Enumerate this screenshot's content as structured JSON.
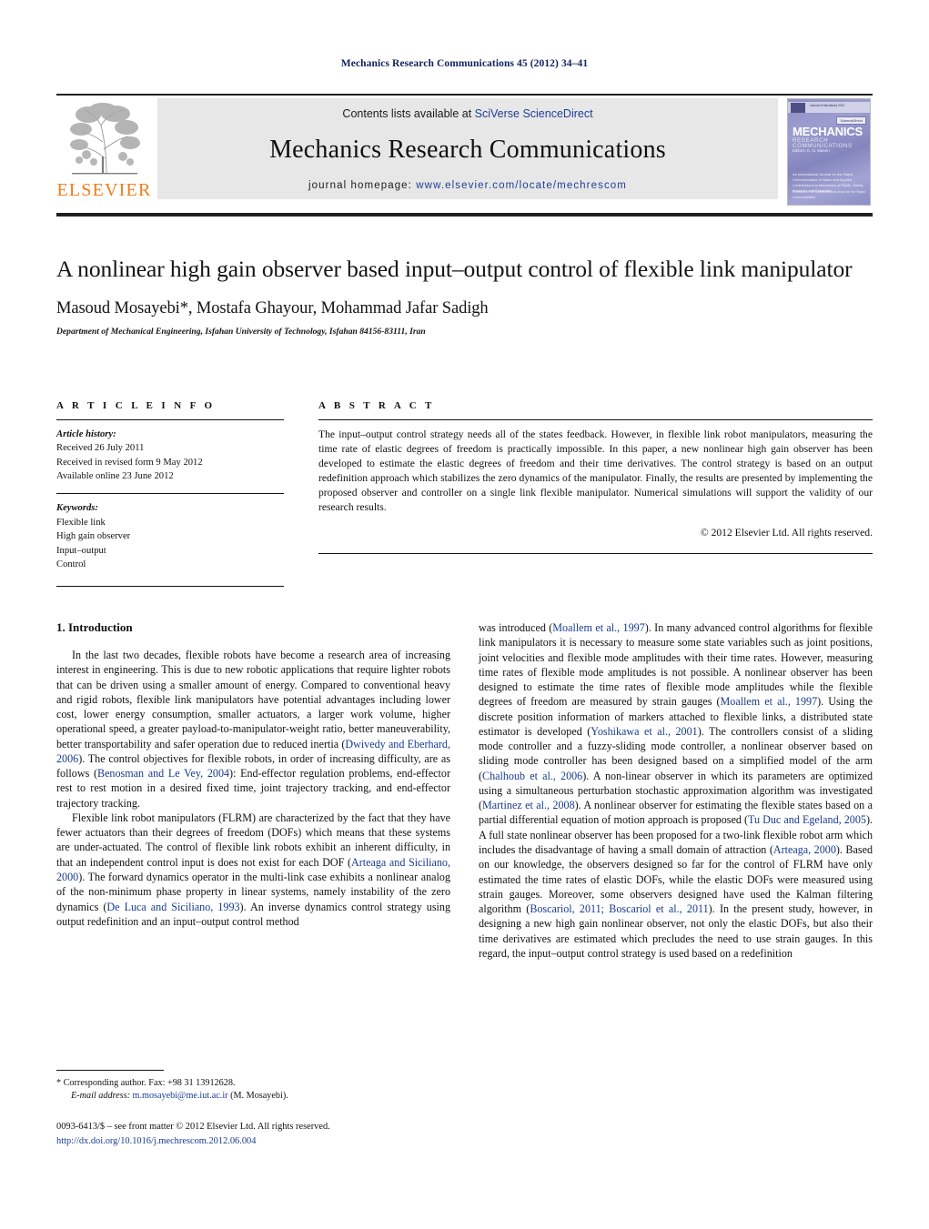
{
  "running_head": {
    "journal": "Mechanics Research Communications",
    "citation": "45 (2012) 34–41"
  },
  "masthead": {
    "publisher_name": "ELSEVIER",
    "contents_prefix": "Contents lists available at ",
    "contents_link": "SciVerse ScienceDirect",
    "journal_title": "Mechanics Research Communications",
    "homepage_prefix": "journal homepage: ",
    "homepage_url": "www.elsevier.com/locate/mechrescom",
    "cover": {
      "title_line1": "MECHANICS",
      "title_line2": "RESEARCH COMMUNICATIONS",
      "editor": "Editors: K. G. Manen",
      "badge": "ScienceDirect",
      "top_text": "Journal of Mechanics 2012",
      "blurb": "An International Journal for the Rapid Communication of Basic and Applied Contributions in Mechanics of Fluids, Solids, Materials and Dynamics",
      "footer": "Founded in 1973\nInternational Union for the Rapid Communication"
    }
  },
  "article": {
    "title": "A nonlinear high gain observer based input–output control of flexible link manipulator",
    "authors": "Masoud Mosayebi*, Mostafa Ghayour, Mohammad Jafar Sadigh",
    "affiliation": "Department of Mechanical Engineering, Isfahan University of Technology, Isfahan 84156-83111, Iran"
  },
  "article_info": {
    "heading": "A R T I C L E     I N F O",
    "history_label": "Article history:",
    "history": [
      "Received 26 July 2011",
      "Received in revised form 9 May 2012",
      "Available online 23 June 2012"
    ],
    "keywords_label": "Keywords:",
    "keywords": [
      "Flexible link",
      "High gain observer",
      "Input–output",
      "Control"
    ]
  },
  "abstract": {
    "heading": "A B S T R A C T",
    "text": "The input–output control strategy needs all of the states feedback. However, in flexible link robot manipulators, measuring the time rate of elastic degrees of freedom is practically impossible. In this paper, a new nonlinear high gain observer has been developed to estimate the elastic degrees of freedom and their time derivatives. The control strategy is based on an output redefinition approach which stabilizes the zero dynamics of the manipulator. Finally, the results are presented by implementing the proposed observer and controller on a single link flexible manipulator. Numerical simulations will support the validity of our research results.",
    "copyright": "© 2012 Elsevier Ltd. All rights reserved."
  },
  "body": {
    "section_number_title": "1.  Introduction",
    "left_paragraphs": [
      {
        "runs": [
          {
            "t": "In the last two decades, flexible robots have become a research area of increasing interest in engineering. This is due to new robotic applications that require lighter robots that can be driven using a smaller amount of energy. Compared to conventional heavy and rigid robots, flexible link manipulators have potential advantages including lower cost, lower energy consumption, smaller actuators, a larger work volume, higher operational speed, a greater payload-to-manipulator-weight ratio, better maneuverability, better transportability and safer operation due to reduced inertia ("
          },
          {
            "t": "Dwivedy and Eberhard, 2006",
            "cite": true
          },
          {
            "t": "). The control objectives for flexible robots, in order of increasing difficulty, are as follows ("
          },
          {
            "t": "Benosman and Le Vey, 2004",
            "cite": true
          },
          {
            "t": "): End-effector regulation problems, end-effector rest to rest motion in a desired fixed time, joint trajectory tracking, and end-effector trajectory tracking."
          }
        ]
      },
      {
        "runs": [
          {
            "t": "Flexible link robot manipulators (FLRM) are characterized by the fact that they have fewer actuators than their degrees of freedom (DOFs) which means that these systems are under-actuated. The control of flexible link robots exhibit an inherent difficulty, in that an independent control input is does not exist for each DOF ("
          },
          {
            "t": "Arteaga and Siciliano, 2000",
            "cite": true
          },
          {
            "t": "). The forward dynamics operator in the multi-link case exhibits a nonlinear analog of the non-minimum phase property in linear systems, namely instability of the zero dynamics ("
          },
          {
            "t": "De Luca and Siciliano, 1993",
            "cite": true
          },
          {
            "t": "). An inverse dynamics control strategy using output redefinition and an input–output control method"
          }
        ]
      }
    ],
    "right_paragraphs": [
      {
        "runs": [
          {
            "t": "was introduced ("
          },
          {
            "t": "Moallem et al., 1997",
            "cite": true
          },
          {
            "t": "). In many advanced control algorithms for flexible link manipulators it is necessary to measure some state variables such as joint positions, joint velocities and flexible mode amplitudes with their time rates. However, measuring time rates of flexible mode amplitudes is not possible. A nonlinear observer has been designed to estimate the time rates of flexible mode amplitudes while the flexible degrees of freedom are measured by strain gauges ("
          },
          {
            "t": "Moallem et al., 1997",
            "cite": true
          },
          {
            "t": "). Using the discrete position information of markers attached to flexible links, a distributed state estimator is developed ("
          },
          {
            "t": "Yoshikawa et al., 2001",
            "cite": true
          },
          {
            "t": "). The controllers consist of a sliding mode controller and a fuzzy-sliding mode controller, a nonlinear observer based on sliding mode controller has been designed based on a simplified model of the arm ("
          },
          {
            "t": "Chalhoub et al., 2006",
            "cite": true
          },
          {
            "t": "). A non-linear observer in which its parameters are optimized using a simultaneous perturbation stochastic approximation algorithm was investigated ("
          },
          {
            "t": "Martinez et al., 2008",
            "cite": true
          },
          {
            "t": "). A nonlinear observer for estimating the flexible states based on a partial differential equation of motion approach is proposed ("
          },
          {
            "t": "Tu Duc and Egeland, 2005",
            "cite": true
          },
          {
            "t": "). A full state nonlinear observer has been proposed for a two-link flexible robot arm which includes the disadvantage of having a small domain of attraction ("
          },
          {
            "t": "Arteaga, 2000",
            "cite": true
          },
          {
            "t": "). Based on our knowledge, the observers designed so far for the control of FLRM have only estimated the time rates of elastic DOFs, while the elastic DOFs were measured using strain gauges. Moreover, some observers designed have used the Kalman filtering algorithm ("
          },
          {
            "t": "Boscariol, 2011; Boscariol et al., 2011",
            "cite": true
          },
          {
            "t": "). In the present study, however, in designing a new high gain nonlinear observer, not only the elastic DOFs, but also their time derivatives are estimated which precludes the need to use strain gauges. In this regard, the input–output control strategy is used based on a redefinition"
          }
        ]
      }
    ]
  },
  "footnote": {
    "corresponding": "* Corresponding author. Fax: +98 31 13912628.",
    "email_label": "E-mail address:",
    "email": "m.mosayebi@me.iut.ac.ir",
    "email_suffix": "(M. Mosayebi)."
  },
  "footer": {
    "issn_line": "0093-6413/$ – see front matter © 2012 Elsevier Ltd. All rights reserved.",
    "doi_line": "http://dx.doi.org/10.1016/j.mechrescom.2012.06.004"
  },
  "colors": {
    "link": "#173b8f",
    "running_head": "#12215e",
    "elsevier_orange": "#f07d1a",
    "band_bg": "#e7e7e7"
  }
}
